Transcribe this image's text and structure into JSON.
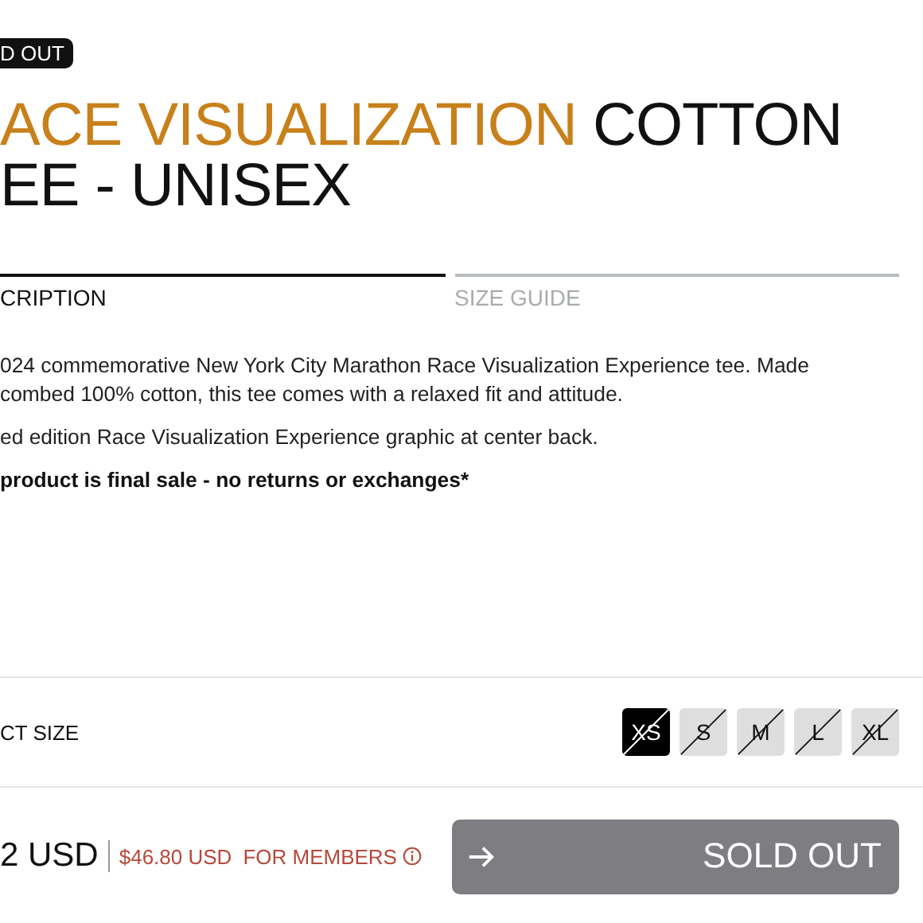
{
  "badge": "D OUT",
  "title": {
    "highlight": "ACE VISUALIZATION",
    "rest": [
      "COTTON",
      "EE - UNISEX"
    ]
  },
  "tabs": [
    {
      "label": "CRIPTION",
      "selected": true
    },
    {
      "label": "SIZE GUIDE",
      "selected": false
    }
  ],
  "description": [
    {
      "lines": [
        "024 commemorative New York City Marathon Race Visualization Experience tee. Made",
        "combed 100% cotton, this tee comes with a relaxed fit and attitude."
      ],
      "bold": false
    },
    {
      "lines": [
        "ed edition Race Visualization Experience graphic at center back."
      ],
      "bold": false
    },
    {
      "lines": [
        "product is final sale - no returns or exchanges*"
      ],
      "bold": true
    }
  ],
  "size_label": "CT SIZE",
  "sizes": [
    {
      "label": "XS",
      "selected": true,
      "available": false
    },
    {
      "label": "S",
      "selected": false,
      "available": false
    },
    {
      "label": "M",
      "selected": false,
      "available": false
    },
    {
      "label": "L",
      "selected": false,
      "available": false
    },
    {
      "label": "XL",
      "selected": false,
      "available": false
    }
  ],
  "price": "2 USD",
  "member_price": "$46.80 USD",
  "member_label": "FOR MEMBERS",
  "button": {
    "label": "SOLD OUT",
    "disabled": true
  }
}
